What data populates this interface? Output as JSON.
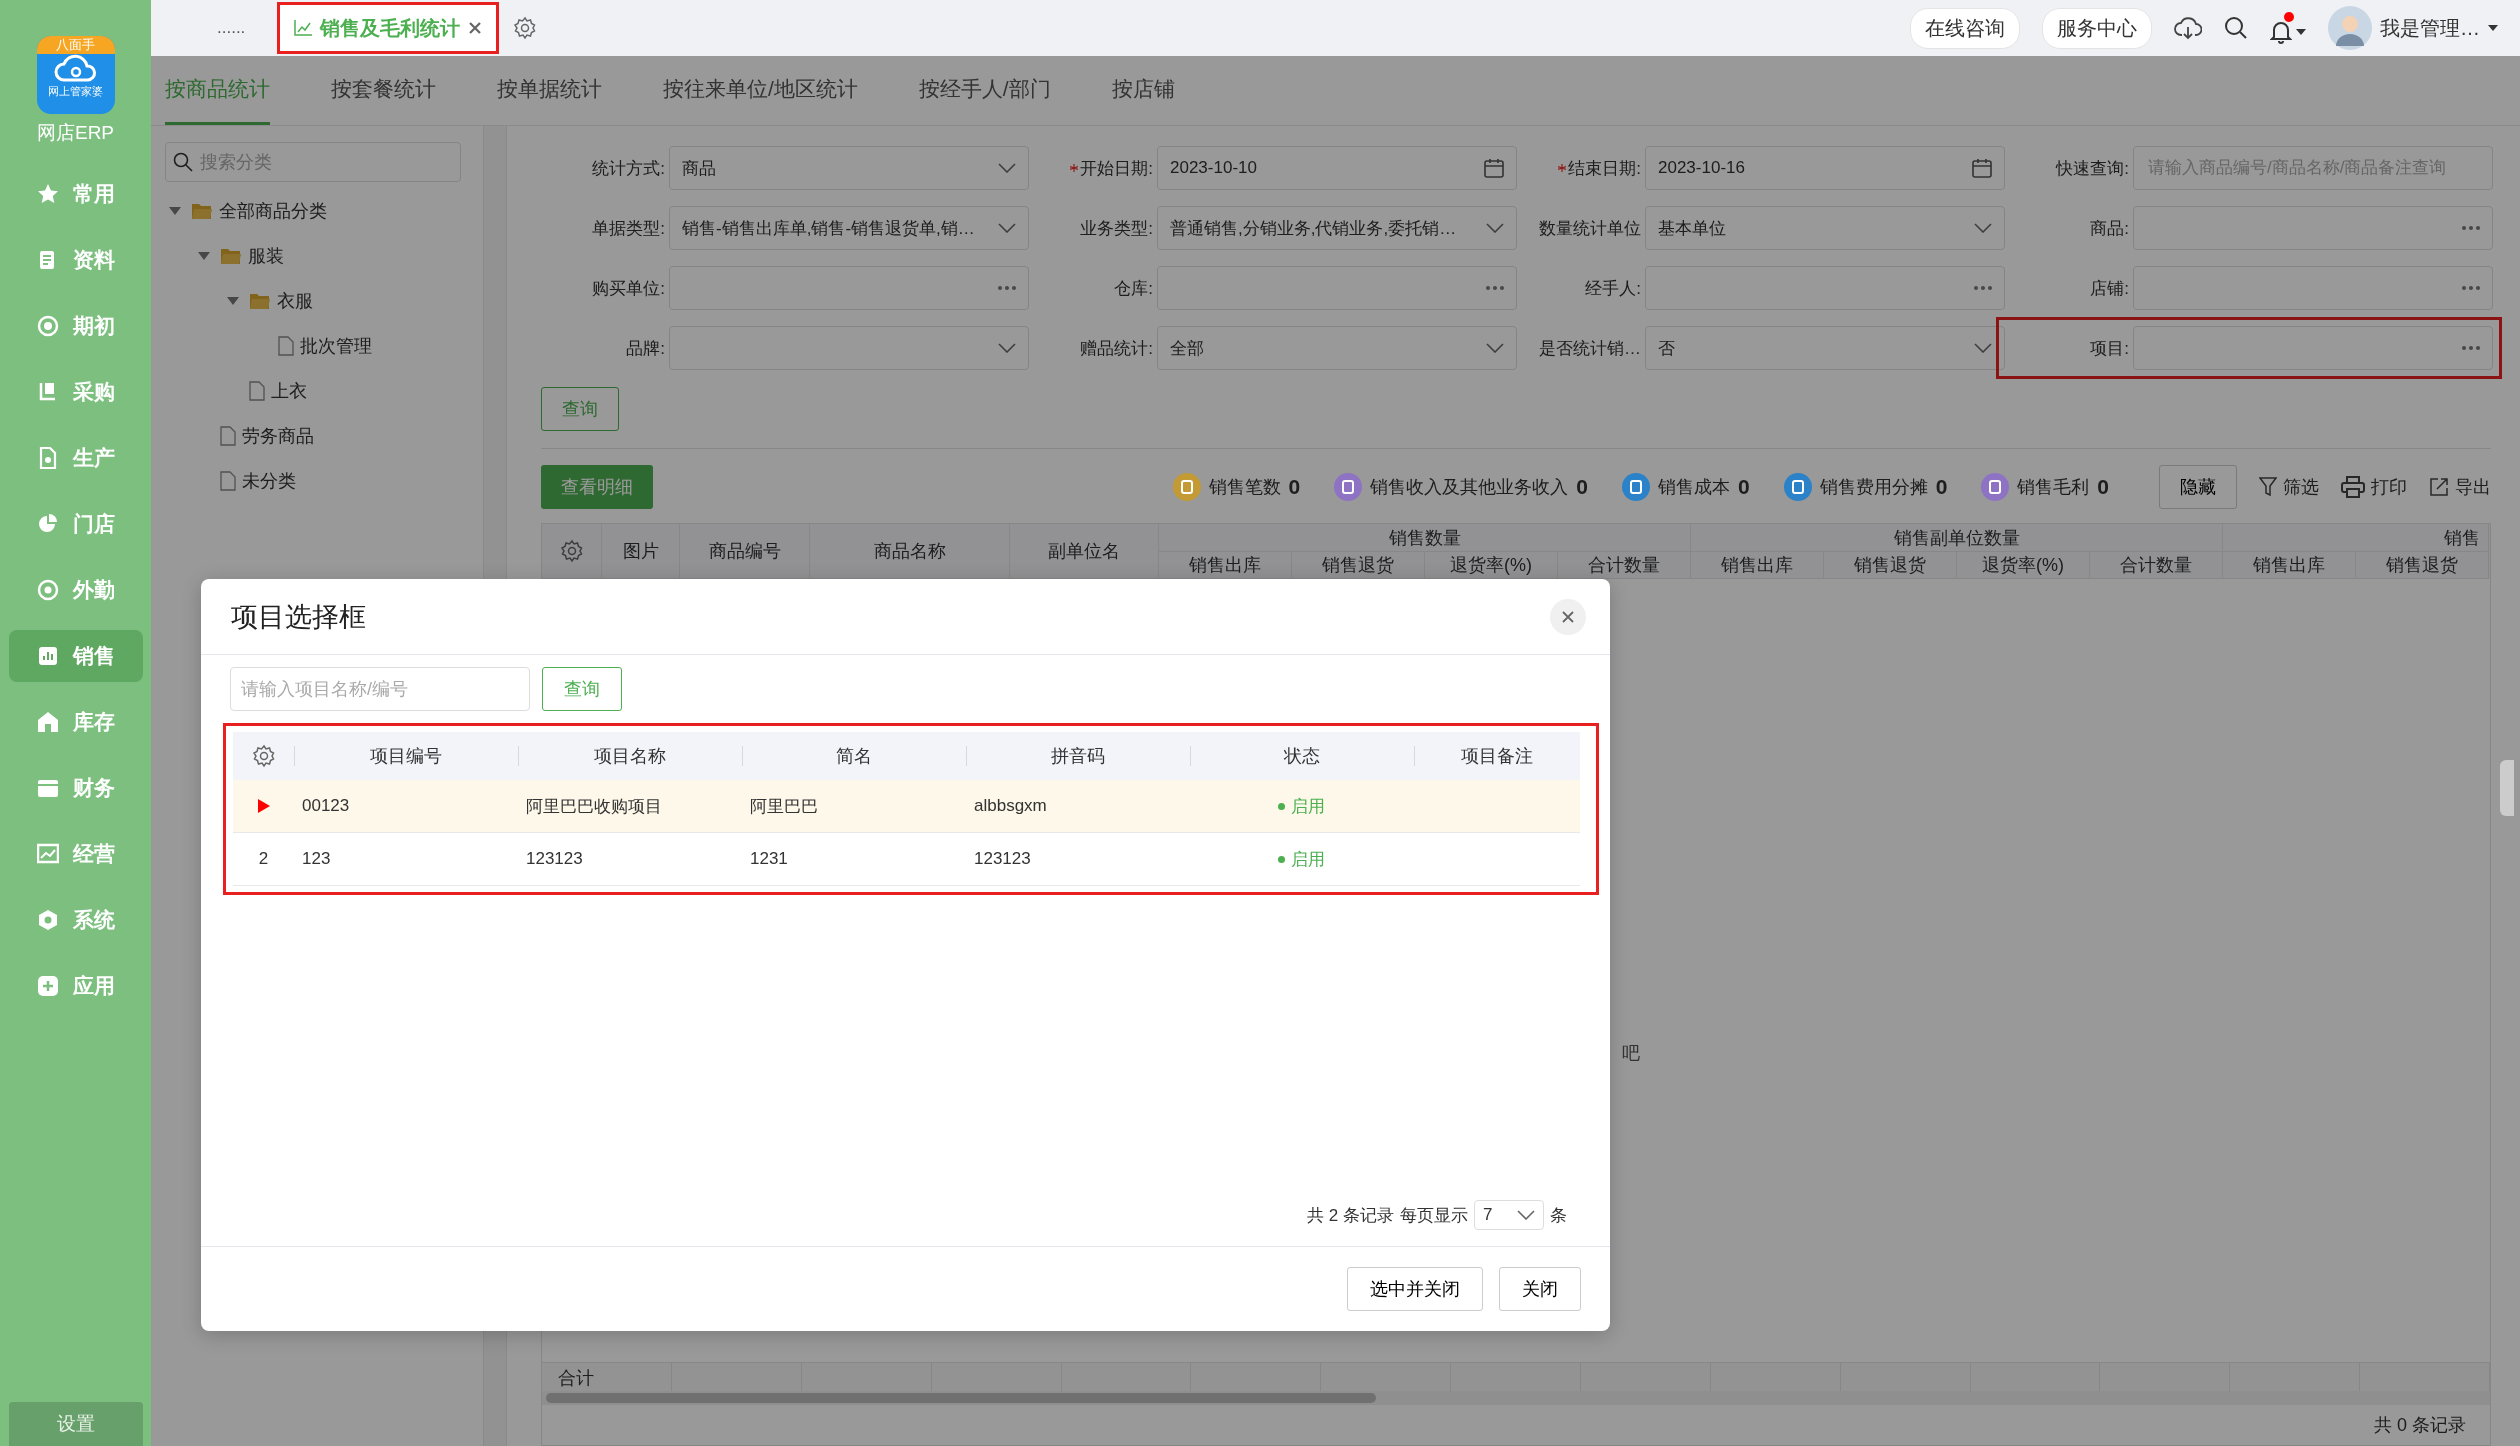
{
  "top_bar": {
    "more": "......",
    "tabs": [
      {
        "label": "销售及毛利统计",
        "selected": true,
        "annotated": true
      }
    ],
    "links": [
      "在线咨询",
      "服务中心"
    ],
    "unread": true,
    "user": "我是管理…"
  },
  "sidebar": {
    "logo_badge": "八面手",
    "logo_text": "网上管家婆",
    "app_name": "网店ERP",
    "items": [
      {
        "label": "常用",
        "selected": false
      },
      {
        "label": "资料",
        "selected": false
      },
      {
        "label": "期初",
        "selected": false
      },
      {
        "label": "采购",
        "selected": false
      },
      {
        "label": "生产",
        "selected": false
      },
      {
        "label": "门店",
        "selected": false
      },
      {
        "label": "外勤",
        "selected": false
      },
      {
        "label": "销售",
        "selected": true
      },
      {
        "label": "库存",
        "selected": false
      },
      {
        "label": "财务",
        "selected": false
      },
      {
        "label": "经营",
        "selected": false
      },
      {
        "label": "系统",
        "selected": false
      },
      {
        "label": "应用",
        "selected": false
      }
    ],
    "settings": "设置"
  },
  "sub_tabs": [
    {
      "label": "按商品统计",
      "selected": true
    },
    {
      "label": "按套餐统计",
      "selected": false
    },
    {
      "label": "按单据统计",
      "selected": false
    },
    {
      "label": "按往来单位/地区统计",
      "selected": false
    },
    {
      "label": "按经手人/部门",
      "selected": false
    },
    {
      "label": "按店铺",
      "selected": false
    }
  ],
  "category_tree": {
    "placeholder": "搜索分类",
    "nodes": [
      {
        "label": "全部商品分类",
        "kind": "folder",
        "expanded": true,
        "children": [
          {
            "label": "服装",
            "kind": "folder",
            "expanded": true,
            "children": [
              {
                "label": "衣服",
                "kind": "folder",
                "expanded": true,
                "children": [
                  {
                    "label": "批次管理",
                    "kind": "file"
                  }
                ]
              },
              {
                "label": "上衣",
                "kind": "file"
              }
            ]
          },
          {
            "label": "劳务商品",
            "kind": "file"
          },
          {
            "label": "未分类",
            "kind": "file"
          }
        ]
      }
    ]
  },
  "filters": [
    {
      "label": "统计方式:",
      "kind": "select",
      "value": "商品"
    },
    {
      "label": "开始日期:",
      "kind": "date",
      "required": true,
      "value": "2023-10-10"
    },
    {
      "label": "结束日期:",
      "kind": "date",
      "required": true,
      "value": "2023-10-16"
    },
    {
      "label": "快速查询:",
      "kind": "text",
      "placeholder": "请输入商品编号/商品名称/商品备注查询"
    },
    {
      "label": "单据类型:",
      "kind": "select",
      "value": "销售-销售出库单,销售-销售退货单,销…"
    },
    {
      "label": "业务类型:",
      "kind": "select",
      "value": "普通销售,分销业务,代销业务,委托销…"
    },
    {
      "label": "数量统计单位",
      "kind": "select",
      "value": "基本单位"
    },
    {
      "label": "商品:",
      "kind": "picker"
    },
    {
      "label": "购买单位:",
      "kind": "picker"
    },
    {
      "label": "仓库:",
      "kind": "picker"
    },
    {
      "label": "经手人:",
      "kind": "picker"
    },
    {
      "label": "店铺:",
      "kind": "picker"
    },
    {
      "label": "品牌:",
      "kind": "select"
    },
    {
      "label": "赠品统计:",
      "kind": "select",
      "value": "全部"
    },
    {
      "label": "是否统计销…",
      "kind": "select",
      "value": "否"
    },
    {
      "label": "项目:",
      "kind": "picker",
      "annotated": true
    }
  ],
  "query_button": "查询",
  "toolbar": {
    "detail_button": "查看明细",
    "stats": [
      {
        "label": "销售笔数",
        "value": "0",
        "color": "#c49a35"
      },
      {
        "label": "销售收入及其他业务收入",
        "value": "0",
        "color": "#8e72c4"
      },
      {
        "label": "销售成本",
        "value": "0",
        "color": "#2b82c8"
      },
      {
        "label": "销售费用分摊",
        "value": "0",
        "color": "#2b82c8"
      },
      {
        "label": "销售毛利",
        "value": "0",
        "color": "#8e72c4"
      }
    ],
    "hide_button": "隐藏",
    "actions": [
      "筛选",
      "打印",
      "导出"
    ]
  },
  "report_table": {
    "columns": [
      "图片",
      "商品编号",
      "商品名称",
      "副单位名"
    ],
    "groups": [
      {
        "label": "销售数量",
        "columns": [
          "销售出库",
          "销售退货",
          "退货率(%)",
          "合计数量"
        ]
      },
      {
        "label": "销售副单位数量",
        "columns": [
          "销售出库",
          "销售退货",
          "退货率(%)",
          "合计数量"
        ]
      },
      {
        "label": "销售",
        "columns": [
          "销售出库",
          "销售退货"
        ]
      }
    ],
    "empty_text": "吧",
    "total_label": "合计",
    "record_count": "共 0 条记录"
  },
  "dialog": {
    "title": "项目选择框",
    "search_placeholder": "请输入项目名称/编号",
    "search_button": "查询",
    "annotated": true,
    "columns": [
      "项目编号",
      "项目名称",
      "简名",
      "拼音码",
      "状态",
      "项目备注"
    ],
    "rows": [
      {
        "selected": true,
        "code": "00123",
        "name": "阿里巴巴收购项目",
        "short_name": "阿里巴巴",
        "pinyin": "albbsgxm",
        "status": "启用",
        "enabled": true
      },
      {
        "selected": false,
        "number": "2",
        "code": "123",
        "name": "123123",
        "short_name": "1231",
        "pinyin": "123123",
        "status": "启用",
        "enabled": true
      }
    ],
    "pagination": {
      "total": "共 2 条记录",
      "page_size_label": "每页显示",
      "page_size": "7",
      "unit": "条"
    },
    "buttons": [
      "选中并关闭",
      "关闭"
    ]
  }
}
